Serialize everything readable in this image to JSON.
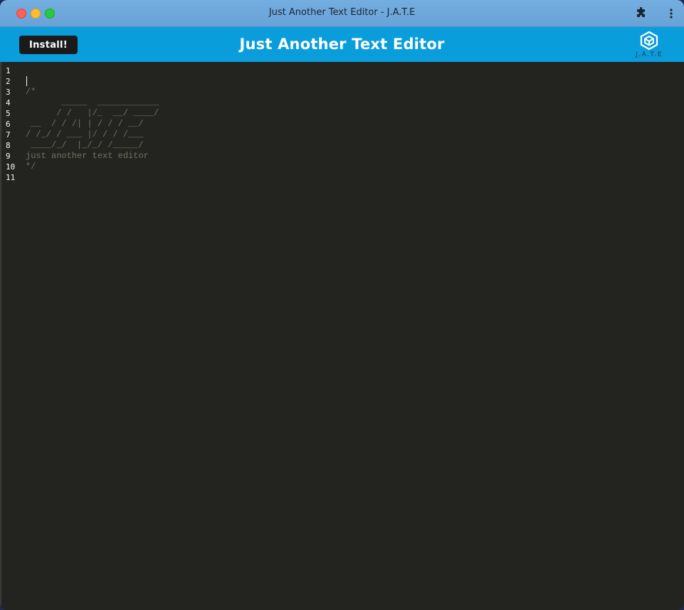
{
  "window": {
    "title": "Just Another Text Editor - J.A.T.E"
  },
  "toolbar": {
    "extensions_icon": "puzzle-icon",
    "menu_icon": "kebab-menu-icon"
  },
  "header": {
    "install_label": "Install!",
    "title": "Just Another Text Editor",
    "logo_text": "J.A.T.E",
    "logo_icon": "cube-logo-icon",
    "bar_color": "#0a9ddc"
  },
  "editor": {
    "background": "#23241f",
    "lines": [
      {
        "num": "1",
        "text": ""
      },
      {
        "num": "2",
        "text": ""
      },
      {
        "num": "3",
        "text": "/*"
      },
      {
        "num": "4",
        "text": "       _____  ____________"
      },
      {
        "num": "5",
        "text": "      / /   |/_  __/ ____/"
      },
      {
        "num": "6",
        "text": " __  / / /| | / / / __/"
      },
      {
        "num": "7",
        "text": "/ /_/ / ___ |/ / / /___"
      },
      {
        "num": "8",
        "text": " ____/_/  |_/_/ /_____/"
      },
      {
        "num": "9",
        "text": "just another text editor"
      },
      {
        "num": "10",
        "text": "*/"
      },
      {
        "num": "11",
        "text": ""
      }
    ]
  }
}
